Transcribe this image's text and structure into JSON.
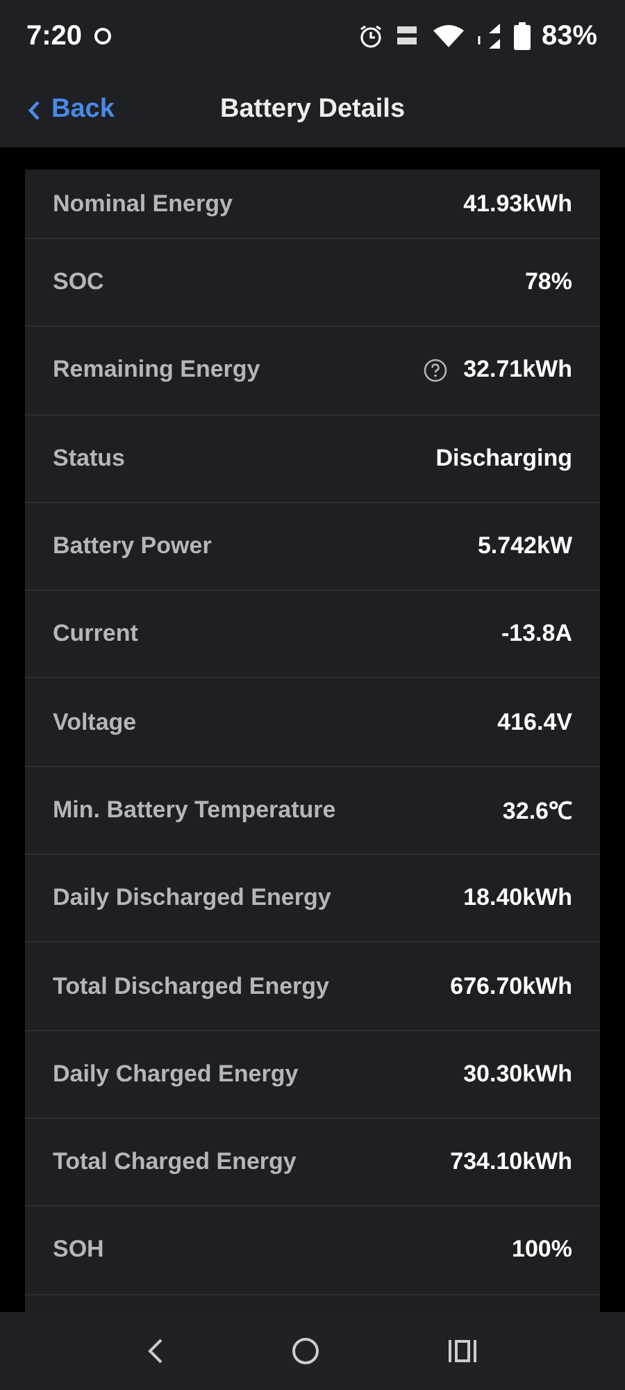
{
  "status_bar": {
    "time": "7:20",
    "battery": "83%"
  },
  "header": {
    "back": "Back",
    "title": "Battery Details"
  },
  "rows": [
    {
      "label": "Nominal Energy",
      "value": "41.93kWh",
      "info": false
    },
    {
      "label": "SOC",
      "value": "78%",
      "info": false
    },
    {
      "label": "Remaining Energy",
      "value": "32.71kWh",
      "info": true
    },
    {
      "label": "Status",
      "value": "Discharging",
      "info": false
    },
    {
      "label": "Battery Power",
      "value": "5.742kW",
      "info": false
    },
    {
      "label": "Current",
      "value": "-13.8A",
      "info": false
    },
    {
      "label": "Voltage",
      "value": "416.4V",
      "info": false
    },
    {
      "label": "Min. Battery Temperature",
      "value": "32.6℃",
      "info": false
    },
    {
      "label": "Daily Discharged Energy",
      "value": "18.40kWh",
      "info": false
    },
    {
      "label": "Total Discharged Energy",
      "value": "676.70kWh",
      "info": false
    },
    {
      "label": "Daily Charged Energy",
      "value": "30.30kWh",
      "info": false
    },
    {
      "label": "Total Charged Energy",
      "value": "734.10kWh",
      "info": false
    },
    {
      "label": "SOH",
      "value": "100%",
      "info": false
    }
  ]
}
